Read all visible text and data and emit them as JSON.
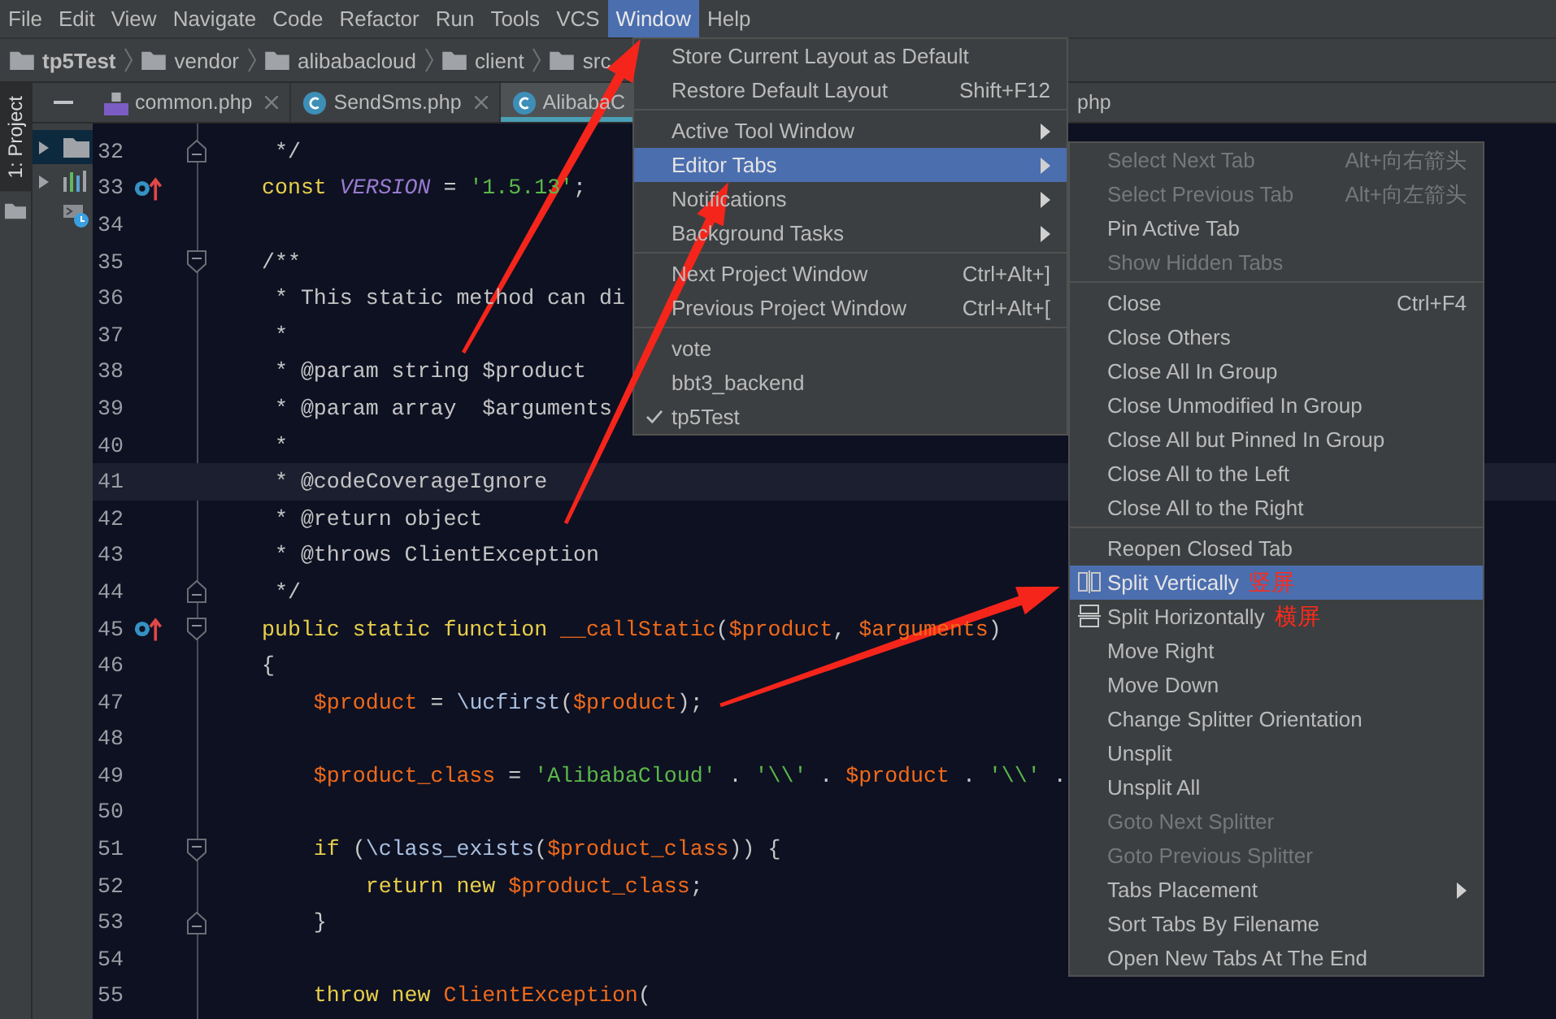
{
  "menu_bar": [
    {
      "label": "File",
      "selected": false
    },
    {
      "label": "Edit",
      "selected": false
    },
    {
      "label": "View",
      "selected": false
    },
    {
      "label": "Navigate",
      "selected": false
    },
    {
      "label": "Code",
      "selected": false
    },
    {
      "label": "Refactor",
      "selected": false
    },
    {
      "label": "Run",
      "selected": false
    },
    {
      "label": "Tools",
      "selected": false
    },
    {
      "label": "VCS",
      "selected": false
    },
    {
      "label": "Window",
      "selected": true
    },
    {
      "label": "Help",
      "selected": false
    }
  ],
  "breadcrumbs": [
    {
      "label": "tp5Test"
    },
    {
      "label": "vendor"
    },
    {
      "label": "alibabacloud"
    },
    {
      "label": "client"
    },
    {
      "label": "src"
    }
  ],
  "tool_window_stripe": {
    "label": "1: Project",
    "selected": true
  },
  "tabs": [
    {
      "label": "common.php",
      "kind": "php",
      "selected": false
    },
    {
      "label": "SendSms.php",
      "kind": "class",
      "selected": false
    },
    {
      "label": "AlibabaC",
      "kind": "class",
      "selected": true
    },
    {
      "label": "php",
      "kind": "fragment",
      "selected": false
    }
  ],
  "editor": {
    "lines": [
      {
        "number": "32",
        "current": false,
        "fold_end": true,
        "tokens": [
          {
            "text": " */",
            "kind": "comment"
          }
        ]
      },
      {
        "number": "33",
        "current": false,
        "overrides": true,
        "tokens": [
          {
            "text": "const ",
            "kind": "keyword"
          },
          {
            "text": "VERSION",
            "kind": "constant"
          },
          {
            "text": " = ",
            "kind": "plain"
          },
          {
            "text": "'1.5.13'",
            "kind": "string"
          },
          {
            "text": ";",
            "kind": "plain"
          }
        ]
      },
      {
        "number": "34",
        "current": false
      },
      {
        "number": "35",
        "current": false,
        "fold_start": true,
        "tokens": [
          {
            "text": "/**",
            "kind": "comment"
          }
        ]
      },
      {
        "number": "36",
        "current": false,
        "tokens": [
          {
            "text": " * This static method can di",
            "kind": "comment"
          }
        ]
      },
      {
        "number": "37",
        "current": false,
        "tokens": [
          {
            "text": " *",
            "kind": "comment"
          }
        ]
      },
      {
        "number": "38",
        "current": false,
        "tokens": [
          {
            "text": " * @param string $product",
            "kind": "comment"
          }
        ]
      },
      {
        "number": "39",
        "current": false,
        "tokens": [
          {
            "text": " * @param array  $arguments",
            "kind": "comment"
          }
        ]
      },
      {
        "number": "40",
        "current": false,
        "tokens": [
          {
            "text": " *",
            "kind": "comment"
          }
        ]
      },
      {
        "number": "41",
        "current": true,
        "tokens": [
          {
            "text": " * @codeCoverageIgnore",
            "kind": "comment"
          }
        ]
      },
      {
        "number": "42",
        "current": false,
        "tokens": [
          {
            "text": " * @return object",
            "kind": "comment"
          }
        ]
      },
      {
        "number": "43",
        "current": false,
        "tokens": [
          {
            "text": " * @throws ClientException",
            "kind": "comment"
          }
        ]
      },
      {
        "number": "44",
        "current": false,
        "fold_end": true,
        "tokens": [
          {
            "text": " */",
            "kind": "comment"
          }
        ]
      },
      {
        "number": "45",
        "current": false,
        "overrides": true,
        "fold_start": true,
        "tokens": [
          {
            "text": "public static function ",
            "kind": "keyword"
          },
          {
            "text": "__callStatic",
            "kind": "variable"
          },
          {
            "text": "(",
            "kind": "plain"
          },
          {
            "text": "$product",
            "kind": "variable"
          },
          {
            "text": ", ",
            "kind": "plain"
          },
          {
            "text": "$arguments",
            "kind": "variable"
          },
          {
            "text": ")",
            "kind": "plain"
          }
        ]
      },
      {
        "number": "46",
        "current": false,
        "tokens": [
          {
            "text": "{",
            "kind": "plain"
          }
        ]
      },
      {
        "number": "47",
        "current": false,
        "tokens": [
          {
            "text": "    $product",
            "kind": "variable"
          },
          {
            "text": " = ",
            "kind": "plain"
          },
          {
            "text": "\\ucfirst",
            "kind": "function"
          },
          {
            "text": "(",
            "kind": "plain"
          },
          {
            "text": "$product",
            "kind": "variable"
          },
          {
            "text": ");",
            "kind": "plain"
          }
        ]
      },
      {
        "number": "48",
        "current": false
      },
      {
        "number": "49",
        "current": false,
        "tokens": [
          {
            "text": "    $product_class",
            "kind": "variable"
          },
          {
            "text": " = ",
            "kind": "plain"
          },
          {
            "text": "'AlibabaCloud'",
            "kind": "string"
          },
          {
            "text": " . ",
            "kind": "plain"
          },
          {
            "text": "'\\\\'",
            "kind": "string"
          },
          {
            "text": " . ",
            "kind": "plain"
          },
          {
            "text": "$product",
            "kind": "variable"
          },
          {
            "text": " . ",
            "kind": "plain"
          },
          {
            "text": "'\\\\'",
            "kind": "string"
          },
          {
            "text": " .",
            "kind": "plain"
          }
        ]
      },
      {
        "number": "50",
        "current": false
      },
      {
        "number": "51",
        "current": false,
        "fold_start": true,
        "tokens": [
          {
            "text": "    if",
            "kind": "keyword"
          },
          {
            "text": " (",
            "kind": "plain"
          },
          {
            "text": "\\class_exists",
            "kind": "function"
          },
          {
            "text": "(",
            "kind": "plain"
          },
          {
            "text": "$product_class",
            "kind": "variable"
          },
          {
            "text": ")) {",
            "kind": "plain"
          }
        ]
      },
      {
        "number": "52",
        "current": false,
        "tokens": [
          {
            "text": "        return new ",
            "kind": "keyword"
          },
          {
            "text": "$product_class",
            "kind": "variable"
          },
          {
            "text": ";",
            "kind": "plain"
          }
        ]
      },
      {
        "number": "53",
        "current": false,
        "fold_end": true,
        "tokens": [
          {
            "text": "    }",
            "kind": "plain"
          }
        ]
      },
      {
        "number": "54",
        "current": false
      },
      {
        "number": "55",
        "current": false,
        "tokens": [
          {
            "text": "    throw new ",
            "kind": "keyword"
          },
          {
            "text": "ClientException",
            "kind": "variable"
          },
          {
            "text": "(",
            "kind": "plain"
          }
        ]
      }
    ]
  },
  "window_menu": [
    {
      "kind": "item",
      "label": "Store Current Layout as Default",
      "selected": false,
      "has_submenu": false,
      "checked": false
    },
    {
      "kind": "item",
      "label": "Restore Default Layout",
      "shortcut": "Shift+F12",
      "selected": false,
      "has_submenu": false,
      "checked": false
    },
    {
      "kind": "separator"
    },
    {
      "kind": "item",
      "label": "Active Tool Window",
      "selected": false,
      "has_submenu": true,
      "checked": false
    },
    {
      "kind": "item",
      "label": "Editor Tabs",
      "selected": true,
      "has_submenu": true,
      "checked": false
    },
    {
      "kind": "item",
      "label": "Notifications",
      "selected": false,
      "has_submenu": true,
      "checked": false
    },
    {
      "kind": "item",
      "label": "Background Tasks",
      "selected": false,
      "has_submenu": true,
      "checked": false
    },
    {
      "kind": "separator"
    },
    {
      "kind": "item",
      "label": "Next Project Window",
      "shortcut": "Ctrl+Alt+]",
      "selected": false,
      "has_submenu": false,
      "checked": false
    },
    {
      "kind": "item",
      "label": "Previous Project Window",
      "shortcut": "Ctrl+Alt+[",
      "selected": false,
      "has_submenu": false,
      "checked": false
    },
    {
      "kind": "separator"
    },
    {
      "kind": "item",
      "label": "vote",
      "selected": false,
      "has_submenu": false,
      "checked": false
    },
    {
      "kind": "item",
      "label": "bbt3_backend",
      "selected": false,
      "has_submenu": false,
      "checked": false
    },
    {
      "kind": "item",
      "label": "tp5Test",
      "selected": false,
      "has_submenu": false,
      "checked": true
    }
  ],
  "editor_tabs_submenu": [
    {
      "kind": "item",
      "label": "Select Next Tab",
      "shortcut": "Alt+向右箭头",
      "disabled": true,
      "selected": false,
      "has_submenu": false
    },
    {
      "kind": "item",
      "label": "Select Previous Tab",
      "shortcut": "Alt+向左箭头",
      "disabled": true,
      "selected": false,
      "has_submenu": false
    },
    {
      "kind": "item",
      "label": "Pin Active Tab",
      "disabled": false,
      "selected": false,
      "has_submenu": false
    },
    {
      "kind": "item",
      "label": "Show Hidden Tabs",
      "disabled": true,
      "selected": false,
      "has_submenu": false
    },
    {
      "kind": "separator"
    },
    {
      "kind": "item",
      "label": "Close",
      "shortcut": "Ctrl+F4",
      "disabled": false,
      "selected": false,
      "has_submenu": false
    },
    {
      "kind": "item",
      "label": "Close Others",
      "disabled": false,
      "selected": false,
      "has_submenu": false
    },
    {
      "kind": "item",
      "label": "Close All In Group",
      "disabled": false,
      "selected": false,
      "has_submenu": false
    },
    {
      "kind": "item",
      "label": "Close Unmodified In Group",
      "disabled": false,
      "selected": false,
      "has_submenu": false
    },
    {
      "kind": "item",
      "label": "Close All but Pinned In Group",
      "disabled": false,
      "selected": false,
      "has_submenu": false
    },
    {
      "kind": "item",
      "label": "Close All to the Left",
      "disabled": false,
      "selected": false,
      "has_submenu": false
    },
    {
      "kind": "item",
      "label": "Close All to the Right",
      "disabled": false,
      "selected": false,
      "has_submenu": false
    },
    {
      "kind": "separator"
    },
    {
      "kind": "item",
      "label": "Reopen Closed Tab",
      "disabled": false,
      "selected": false,
      "has_submenu": false
    },
    {
      "kind": "split_vertical",
      "label": "Split Vertically",
      "annotation": "竖屏",
      "disabled": false,
      "selected": true,
      "has_submenu": false
    },
    {
      "kind": "split_horizontal",
      "label": "Split Horizontally",
      "annotation": "横屏",
      "disabled": false,
      "selected": false,
      "has_submenu": false
    },
    {
      "kind": "item",
      "label": "Move Right",
      "disabled": false,
      "selected": false,
      "has_submenu": false
    },
    {
      "kind": "item",
      "label": "Move Down",
      "disabled": false,
      "selected": false,
      "has_submenu": false
    },
    {
      "kind": "item",
      "label": "Change Splitter Orientation",
      "disabled": false,
      "selected": false,
      "has_submenu": false
    },
    {
      "kind": "item",
      "label": "Unsplit",
      "disabled": false,
      "selected": false,
      "has_submenu": false
    },
    {
      "kind": "item",
      "label": "Unsplit All",
      "disabled": false,
      "selected": false,
      "has_submenu": false
    },
    {
      "kind": "item",
      "label": "Goto Next Splitter",
      "disabled": true,
      "selected": false,
      "has_submenu": false
    },
    {
      "kind": "item",
      "label": "Goto Previous Splitter",
      "disabled": true,
      "selected": false,
      "has_submenu": false
    },
    {
      "kind": "item",
      "label": "Tabs Placement",
      "disabled": false,
      "selected": false,
      "has_submenu": true
    },
    {
      "kind": "item",
      "label": "Sort Tabs By Filename",
      "disabled": false,
      "selected": false,
      "has_submenu": false
    },
    {
      "kind": "item",
      "label": "Open New Tabs At The End",
      "disabled": false,
      "selected": false,
      "has_submenu": false
    }
  ]
}
